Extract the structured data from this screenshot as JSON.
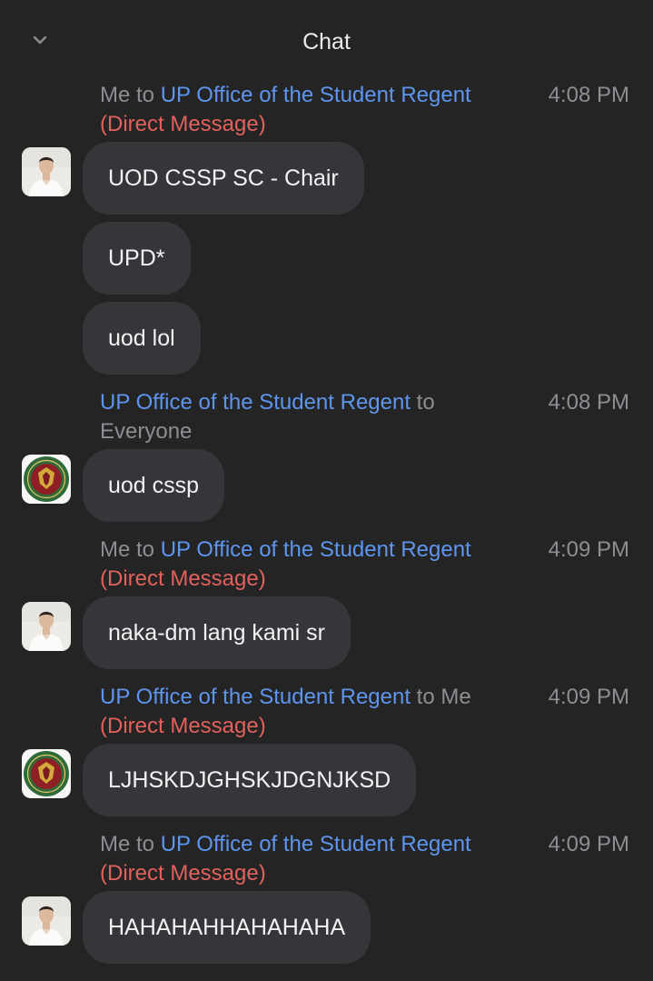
{
  "header": {
    "title": "Chat",
    "collapse_icon": "chevron-down-icon"
  },
  "colors": {
    "background": "#242424",
    "bubble": "#35363a",
    "link": "#5e95ee",
    "direct_message": "#e2615d",
    "muted": "#8d8d93"
  },
  "messages": [
    {
      "meta": {
        "prefix": "Me to ",
        "recipient": "UP Office of the Student Regent",
        "tag": "(Direct Message)"
      },
      "time": "4:08 PM",
      "avatar": "person-avatar",
      "bubbles": [
        "UOD CSSP SC - Chair",
        "UPD*",
        "uod lol"
      ]
    },
    {
      "meta": {
        "sender": "UP Office of the Student Regent",
        "connector": " to",
        "audience": "Everyone"
      },
      "time": "4:08 PM",
      "avatar": "seal-avatar",
      "bubbles": [
        "uod cssp"
      ]
    },
    {
      "meta": {
        "prefix": "Me to ",
        "recipient": "UP Office of the Student Regent",
        "tag": "(Direct Message)"
      },
      "time": "4:09 PM",
      "avatar": "person-avatar",
      "bubbles": [
        "naka-dm lang kami sr"
      ]
    },
    {
      "meta": {
        "sender": "UP Office of the Student Regent",
        "connector": " to Me",
        "tag": "(Direct Message)"
      },
      "time": "4:09 PM",
      "avatar": "seal-avatar",
      "bubbles": [
        "LJHSKDJGHSKJDGNJKSD"
      ]
    },
    {
      "meta": {
        "prefix": "Me to ",
        "recipient": "UP Office of the Student Regent",
        "tag": "(Direct Message)"
      },
      "time": "4:09 PM",
      "avatar": "person-avatar",
      "bubbles": [
        "HAHAHAHHAHAHAHA"
      ]
    }
  ]
}
